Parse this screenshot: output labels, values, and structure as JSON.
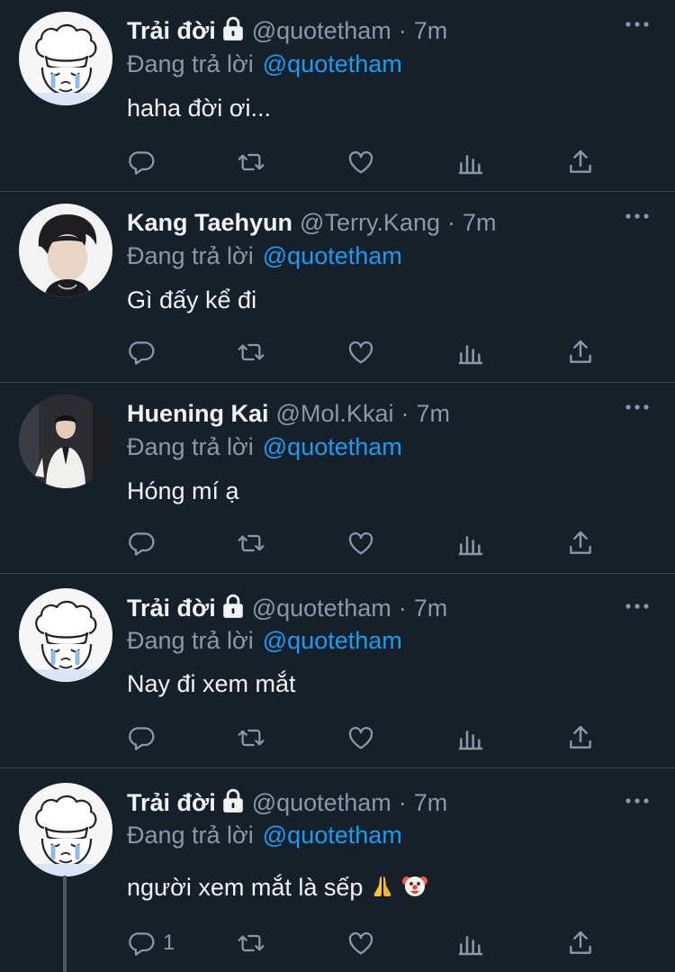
{
  "colors": {
    "background": "#15202b",
    "accent": "#1d9bf0",
    "muted": "#8b98a5",
    "divider": "#38444d"
  },
  "tweets": [
    {
      "avatar": "chef-cartoon",
      "name": "Trải đời",
      "locked": true,
      "handle": "@quotetham",
      "sep": "·",
      "time": "7m",
      "reply_label": "Đang trả lời",
      "reply_to": "@quotetham",
      "text": "haha đời ơi...",
      "reply_count": ""
    },
    {
      "avatar": "person-photo-dark-hair",
      "name": "Kang Taehyun",
      "locked": false,
      "handle": "@Terry.Kang",
      "sep": "·",
      "time": "7m",
      "reply_label": "Đang trả lời",
      "reply_to": "@quotetham",
      "text": "Gì đấy kể đi",
      "reply_count": ""
    },
    {
      "avatar": "person-photo-white-suit",
      "name": "Huening Kai",
      "locked": false,
      "handle": "@Mol.Kkai",
      "sep": "·",
      "time": "7m",
      "reply_label": "Đang trả lời",
      "reply_to": "@quotetham",
      "text": "Hóng mí ạ",
      "reply_count": ""
    },
    {
      "avatar": "chef-cartoon",
      "name": "Trải đời",
      "locked": true,
      "handle": "@quotetham",
      "sep": "·",
      "time": "7m",
      "reply_label": "Đang trả lời",
      "reply_to": "@quotetham",
      "text": "Nay đi xem mắt",
      "reply_count": ""
    },
    {
      "avatar": "chef-cartoon",
      "name": "Trải đời",
      "locked": true,
      "handle": "@quotetham",
      "sep": "·",
      "time": "7m",
      "reply_label": "Đang trả lời",
      "reply_to": "@quotetham",
      "text": "người xem mắt là sếp",
      "reply_count": "1"
    }
  ]
}
